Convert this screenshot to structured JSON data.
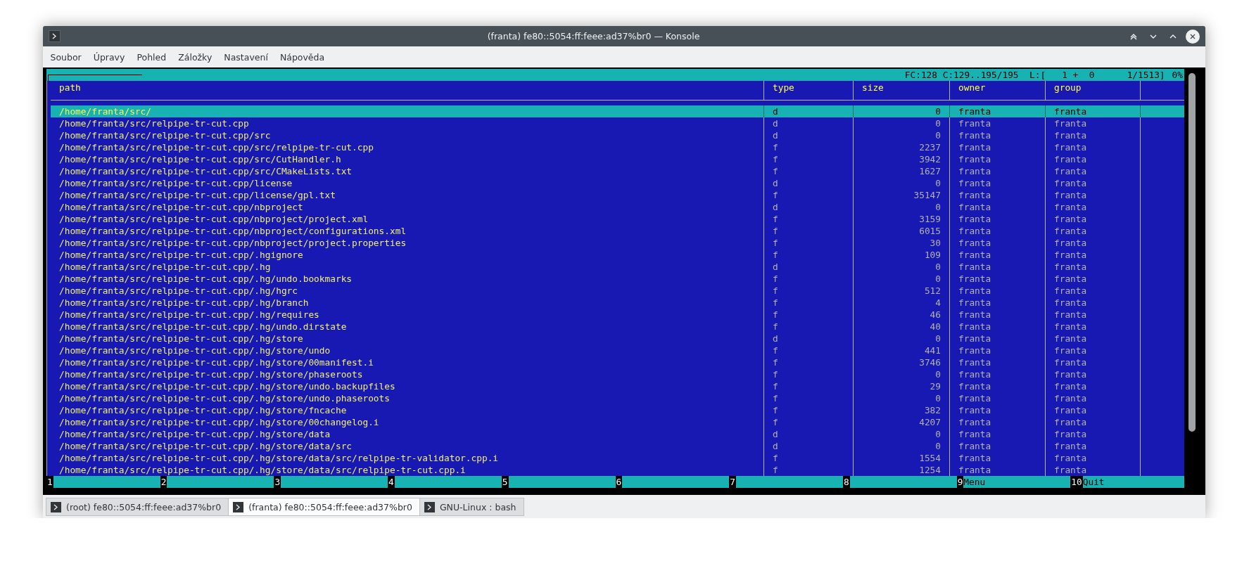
{
  "window": {
    "title": "(franta) fe80::5054:ff:feee:ad37%br0 — Konsole"
  },
  "menu": [
    "Soubor",
    "Úpravy",
    "Pohled",
    "Záložky",
    "Nastavení",
    "Nápověda"
  ],
  "status_line": {
    "text": "FC:128 C:129..195/195  L:[   1 +  0      1/1513]",
    "percent": "0%"
  },
  "table": {
    "columns": [
      "path",
      "type",
      "size",
      "owner",
      "group"
    ],
    "rows": [
      {
        "path": "/home/franta/src/",
        "type": "d",
        "size": "0",
        "owner": "franta",
        "group": "franta",
        "selected": true
      },
      {
        "path": "/home/franta/src/relpipe-tr-cut.cpp",
        "type": "d",
        "size": "0",
        "owner": "franta",
        "group": "franta",
        "selected": false
      },
      {
        "path": "/home/franta/src/relpipe-tr-cut.cpp/src",
        "type": "d",
        "size": "0",
        "owner": "franta",
        "group": "franta",
        "selected": false
      },
      {
        "path": "/home/franta/src/relpipe-tr-cut.cpp/src/relpipe-tr-cut.cpp",
        "type": "f",
        "size": "2237",
        "owner": "franta",
        "group": "franta",
        "selected": false
      },
      {
        "path": "/home/franta/src/relpipe-tr-cut.cpp/src/CutHandler.h",
        "type": "f",
        "size": "3942",
        "owner": "franta",
        "group": "franta",
        "selected": false
      },
      {
        "path": "/home/franta/src/relpipe-tr-cut.cpp/src/CMakeLists.txt",
        "type": "f",
        "size": "1627",
        "owner": "franta",
        "group": "franta",
        "selected": false
      },
      {
        "path": "/home/franta/src/relpipe-tr-cut.cpp/license",
        "type": "d",
        "size": "0",
        "owner": "franta",
        "group": "franta",
        "selected": false
      },
      {
        "path": "/home/franta/src/relpipe-tr-cut.cpp/license/gpl.txt",
        "type": "f",
        "size": "35147",
        "owner": "franta",
        "group": "franta",
        "selected": false
      },
      {
        "path": "/home/franta/src/relpipe-tr-cut.cpp/nbproject",
        "type": "d",
        "size": "0",
        "owner": "franta",
        "group": "franta",
        "selected": false
      },
      {
        "path": "/home/franta/src/relpipe-tr-cut.cpp/nbproject/project.xml",
        "type": "f",
        "size": "3159",
        "owner": "franta",
        "group": "franta",
        "selected": false
      },
      {
        "path": "/home/franta/src/relpipe-tr-cut.cpp/nbproject/configurations.xml",
        "type": "f",
        "size": "6015",
        "owner": "franta",
        "group": "franta",
        "selected": false
      },
      {
        "path": "/home/franta/src/relpipe-tr-cut.cpp/nbproject/project.properties",
        "type": "f",
        "size": "30",
        "owner": "franta",
        "group": "franta",
        "selected": false
      },
      {
        "path": "/home/franta/src/relpipe-tr-cut.cpp/.hgignore",
        "type": "f",
        "size": "109",
        "owner": "franta",
        "group": "franta",
        "selected": false
      },
      {
        "path": "/home/franta/src/relpipe-tr-cut.cpp/.hg",
        "type": "d",
        "size": "0",
        "owner": "franta",
        "group": "franta",
        "selected": false
      },
      {
        "path": "/home/franta/src/relpipe-tr-cut.cpp/.hg/undo.bookmarks",
        "type": "f",
        "size": "0",
        "owner": "franta",
        "group": "franta",
        "selected": false
      },
      {
        "path": "/home/franta/src/relpipe-tr-cut.cpp/.hg/hgrc",
        "type": "f",
        "size": "512",
        "owner": "franta",
        "group": "franta",
        "selected": false
      },
      {
        "path": "/home/franta/src/relpipe-tr-cut.cpp/.hg/branch",
        "type": "f",
        "size": "4",
        "owner": "franta",
        "group": "franta",
        "selected": false
      },
      {
        "path": "/home/franta/src/relpipe-tr-cut.cpp/.hg/requires",
        "type": "f",
        "size": "46",
        "owner": "franta",
        "group": "franta",
        "selected": false
      },
      {
        "path": "/home/franta/src/relpipe-tr-cut.cpp/.hg/undo.dirstate",
        "type": "f",
        "size": "40",
        "owner": "franta",
        "group": "franta",
        "selected": false
      },
      {
        "path": "/home/franta/src/relpipe-tr-cut.cpp/.hg/store",
        "type": "d",
        "size": "0",
        "owner": "franta",
        "group": "franta",
        "selected": false
      },
      {
        "path": "/home/franta/src/relpipe-tr-cut.cpp/.hg/store/undo",
        "type": "f",
        "size": "441",
        "owner": "franta",
        "group": "franta",
        "selected": false
      },
      {
        "path": "/home/franta/src/relpipe-tr-cut.cpp/.hg/store/00manifest.i",
        "type": "f",
        "size": "3746",
        "owner": "franta",
        "group": "franta",
        "selected": false
      },
      {
        "path": "/home/franta/src/relpipe-tr-cut.cpp/.hg/store/phaseroots",
        "type": "f",
        "size": "0",
        "owner": "franta",
        "group": "franta",
        "selected": false
      },
      {
        "path": "/home/franta/src/relpipe-tr-cut.cpp/.hg/store/undo.backupfiles",
        "type": "f",
        "size": "29",
        "owner": "franta",
        "group": "franta",
        "selected": false
      },
      {
        "path": "/home/franta/src/relpipe-tr-cut.cpp/.hg/store/undo.phaseroots",
        "type": "f",
        "size": "0",
        "owner": "franta",
        "group": "franta",
        "selected": false
      },
      {
        "path": "/home/franta/src/relpipe-tr-cut.cpp/.hg/store/fncache",
        "type": "f",
        "size": "382",
        "owner": "franta",
        "group": "franta",
        "selected": false
      },
      {
        "path": "/home/franta/src/relpipe-tr-cut.cpp/.hg/store/00changelog.i",
        "type": "f",
        "size": "4207",
        "owner": "franta",
        "group": "franta",
        "selected": false
      },
      {
        "path": "/home/franta/src/relpipe-tr-cut.cpp/.hg/store/data",
        "type": "d",
        "size": "0",
        "owner": "franta",
        "group": "franta",
        "selected": false
      },
      {
        "path": "/home/franta/src/relpipe-tr-cut.cpp/.hg/store/data/src",
        "type": "d",
        "size": "0",
        "owner": "franta",
        "group": "franta",
        "selected": false
      },
      {
        "path": "/home/franta/src/relpipe-tr-cut.cpp/.hg/store/data/src/relpipe-tr-validator.cpp.i",
        "type": "f",
        "size": "1554",
        "owner": "franta",
        "group": "franta",
        "selected": false
      },
      {
        "path": "/home/franta/src/relpipe-tr-cut.cpp/.hg/store/data/src/relpipe-tr-cut.cpp.i",
        "type": "f",
        "size": "1254",
        "owner": "franta",
        "group": "franta",
        "selected": false
      }
    ]
  },
  "function_keys": [
    {
      "number": "1"
    },
    {
      "number": "2"
    },
    {
      "number": "3"
    },
    {
      "number": "4"
    },
    {
      "number": "5"
    },
    {
      "number": "6"
    },
    {
      "number": "7"
    },
    {
      "number": "8"
    },
    {
      "number": "9",
      "label": "Menu"
    },
    {
      "number": "10",
      "label": "Quit"
    }
  ],
  "tabs": [
    {
      "label": "(root) fe80::5054:ff:feee:ad37%br0",
      "selected": false
    },
    {
      "label": "(franta) fe80::5054:ff:feee:ad37%br0",
      "selected": true
    },
    {
      "label": "GNU-Linux : bash",
      "selected": false
    }
  ]
}
